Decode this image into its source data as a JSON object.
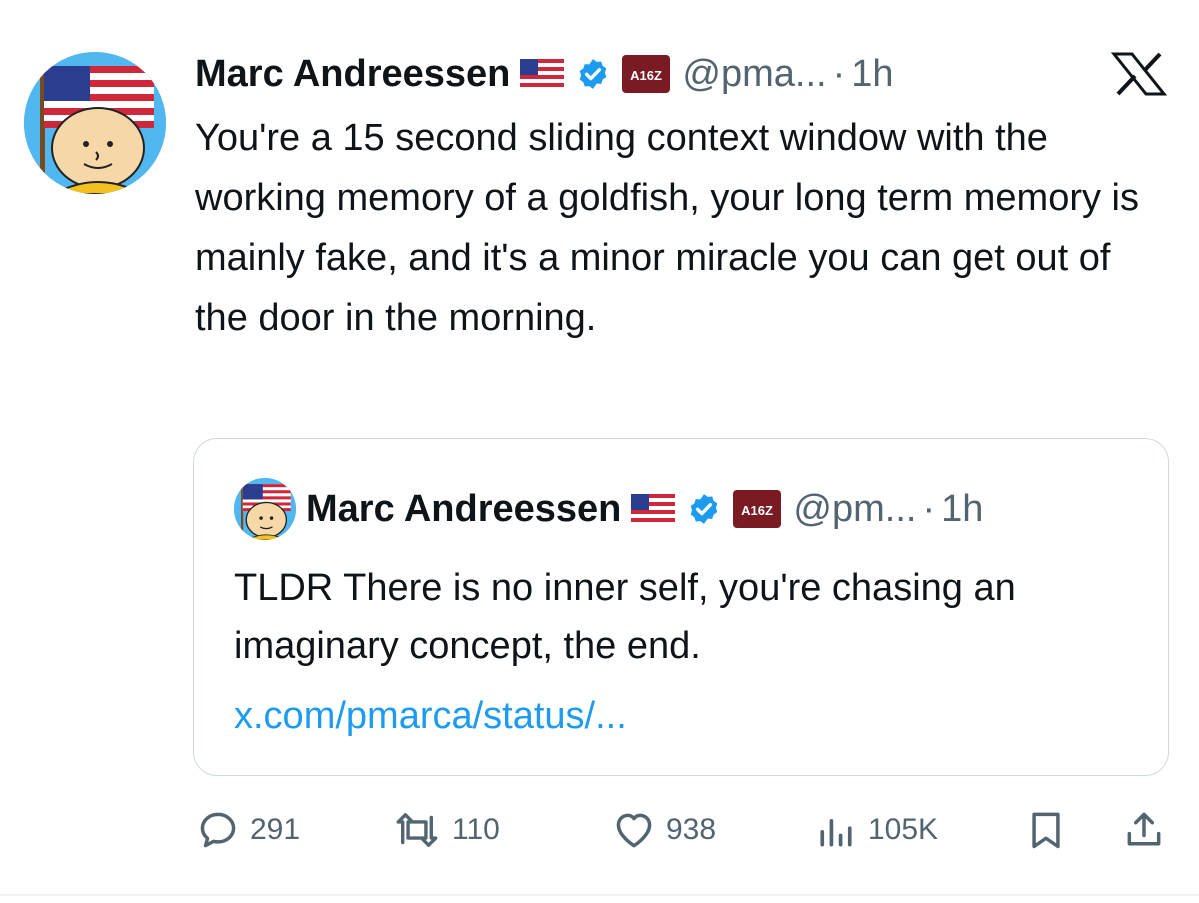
{
  "colors": {
    "text": "#0f1419",
    "muted": "#536471",
    "link": "#1d9bf0",
    "verified": "#1d9bf0",
    "border": "#cfd9de",
    "affiliate_bg": "#7a1a22"
  },
  "tweet": {
    "author_name": "Marc Andreessen",
    "flag": "🇺🇸",
    "affiliate_badge": "A16Z",
    "handle": "@pma...",
    "separator": "·",
    "time": "1h",
    "text": "You're a 15 second sliding context window with the working memory of a goldfish, your long term memory is mainly fake, and it's a minor miracle you can get out of the door in the morning."
  },
  "quoted": {
    "author_name": "Marc Andreessen",
    "flag": "🇺🇸",
    "affiliate_badge": "A16Z",
    "handle": "@pm...",
    "separator": "·",
    "time": "1h",
    "text": "TLDR There is no inner self, you're chasing an imaginary concept, the end.",
    "link": "x.com/pmarca/status/..."
  },
  "actions": {
    "replies": "291",
    "reposts": "110",
    "likes": "938",
    "views": "105K"
  },
  "icons": {
    "reply": "reply-icon",
    "repost": "repost-icon",
    "like": "heart-icon",
    "views": "views-icon",
    "bookmark": "bookmark-icon",
    "share": "share-icon",
    "brand": "x-logo-icon",
    "verified": "verified-badge-icon"
  }
}
